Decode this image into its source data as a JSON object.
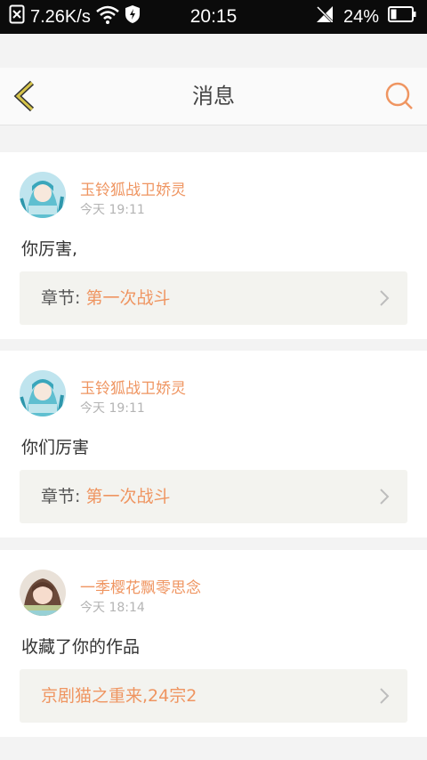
{
  "status_bar": {
    "speed": "7.26K/s",
    "time": "20:15",
    "battery": "24%"
  },
  "header": {
    "title": "消息",
    "back_icon": "chevron-left-icon",
    "search_icon": "search-icon"
  },
  "colors": {
    "accent": "#ef9561",
    "back_arrow": "#d6c44a"
  },
  "messages": [
    {
      "username": "玉铃狐战卫娇灵",
      "time": "今天 19:11",
      "content": "你厉害,",
      "ref_label": "章节:",
      "ref_title": "第一次战斗"
    },
    {
      "username": "玉铃狐战卫娇灵",
      "time": "今天 19:11",
      "content": "你们厉害",
      "ref_label": "章节:",
      "ref_title": "第一次战斗"
    },
    {
      "username": "一季樱花飘零思念",
      "time": "今天 18:14",
      "content": "收藏了你的作品",
      "ref_label": "",
      "ref_title": "京剧猫之重来,24宗2"
    }
  ]
}
